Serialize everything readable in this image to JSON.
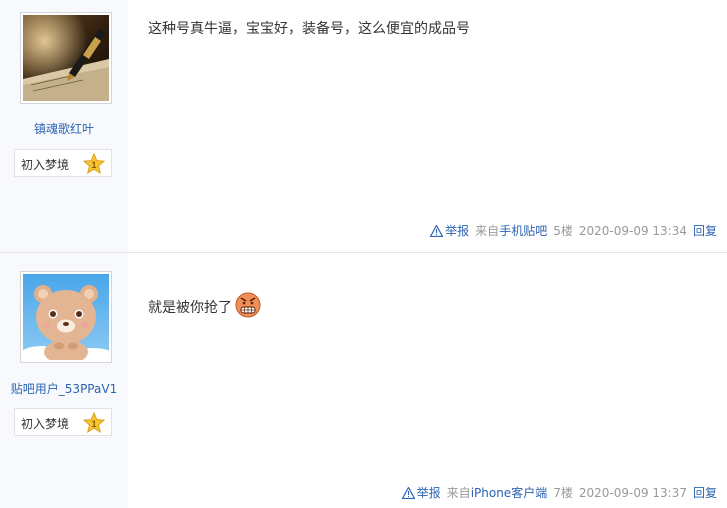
{
  "posts": [
    {
      "username": "镇魂歌红叶",
      "level_name": "初入梦境",
      "level_num": "1",
      "content": "这种号真牛逼，宝宝好，装备号，这么便宜的成品号",
      "report_label": "举报",
      "source_prefix": "来自",
      "source_link": "手机贴吧",
      "floor": "5楼",
      "time": "2020-09-09 13:34",
      "reply_label": "回复"
    },
    {
      "username": "贴吧用户_53PPaV1",
      "level_name": "初入梦境",
      "level_num": "1",
      "content": "就是被你抢了",
      "emoji": "angry-grin-emoji",
      "report_label": "举报",
      "source_prefix": "来自",
      "source_link": "iPhone客户端",
      "floor": "7楼",
      "time": "2020-09-09 13:37",
      "reply_label": "回复"
    }
  ],
  "colors": {
    "link": "#2d64b3",
    "sidebar": "#f7f9fc",
    "meta": "#999999"
  }
}
